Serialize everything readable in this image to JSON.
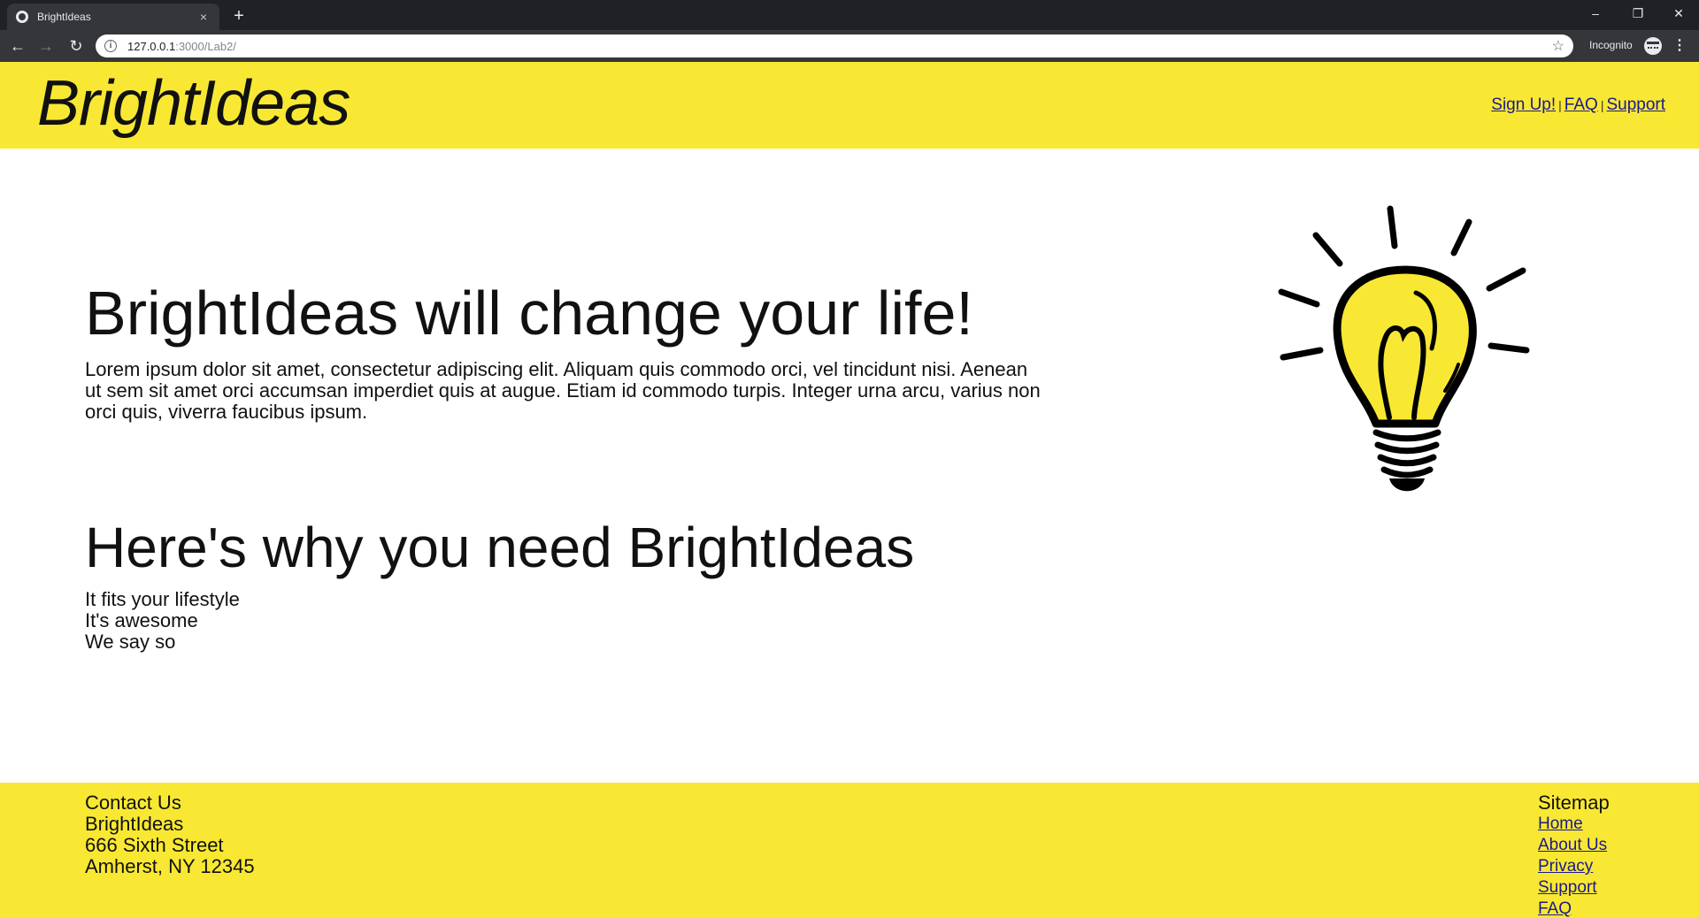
{
  "browser": {
    "tab_title": "BrightIdeas",
    "tab_close_glyph": "×",
    "new_tab_glyph": "+",
    "url_host": "127.0.0.1",
    "url_rest": ":3000/Lab2/",
    "incognito_label": "Incognito",
    "window_controls": {
      "minimize": "–",
      "restore": "❐",
      "close": "✕"
    },
    "nav_glyphs": {
      "back": "←",
      "forward": "→",
      "reload": "↻",
      "star": "☆",
      "menu": "⋮",
      "info": "i"
    }
  },
  "header": {
    "brand": "BrightIdeas",
    "nav": [
      {
        "label": "Sign Up!"
      },
      {
        "label": "FAQ"
      },
      {
        "label": "Support"
      }
    ],
    "separator": "|"
  },
  "main": {
    "hero_title": "BrightIdeas will change your life!",
    "hero_text": "Lorem ipsum dolor sit amet, consectetur adipiscing elit. Aliquam quis commodo orci, vel tincidunt nisi. Aenean ut sem sit amet orci accumsan imperdiet quis at augue. Etiam id commodo turpis. Integer urna arcu, varius non orci quis, viverra faucibus ipsum.",
    "why_title": "Here's why you need BrightIdeas",
    "reasons": [
      "It fits your lifestyle",
      "It's awesome",
      "We say so"
    ],
    "image_icon": "lightbulb-icon"
  },
  "footer": {
    "contact_heading": "Contact Us",
    "contact_lines": [
      "BrightIdeas",
      "666 Sixth Street",
      "Amherst, NY 12345"
    ],
    "sitemap_heading": "Sitemap",
    "sitemap_links": [
      "Home",
      "About Us",
      "Privacy",
      "Support",
      "FAQ"
    ]
  },
  "colors": {
    "brand_yellow": "#f9e833",
    "link": "#1a1a8c",
    "chrome_dark": "#202124",
    "chrome_toolbar": "#35363a"
  }
}
